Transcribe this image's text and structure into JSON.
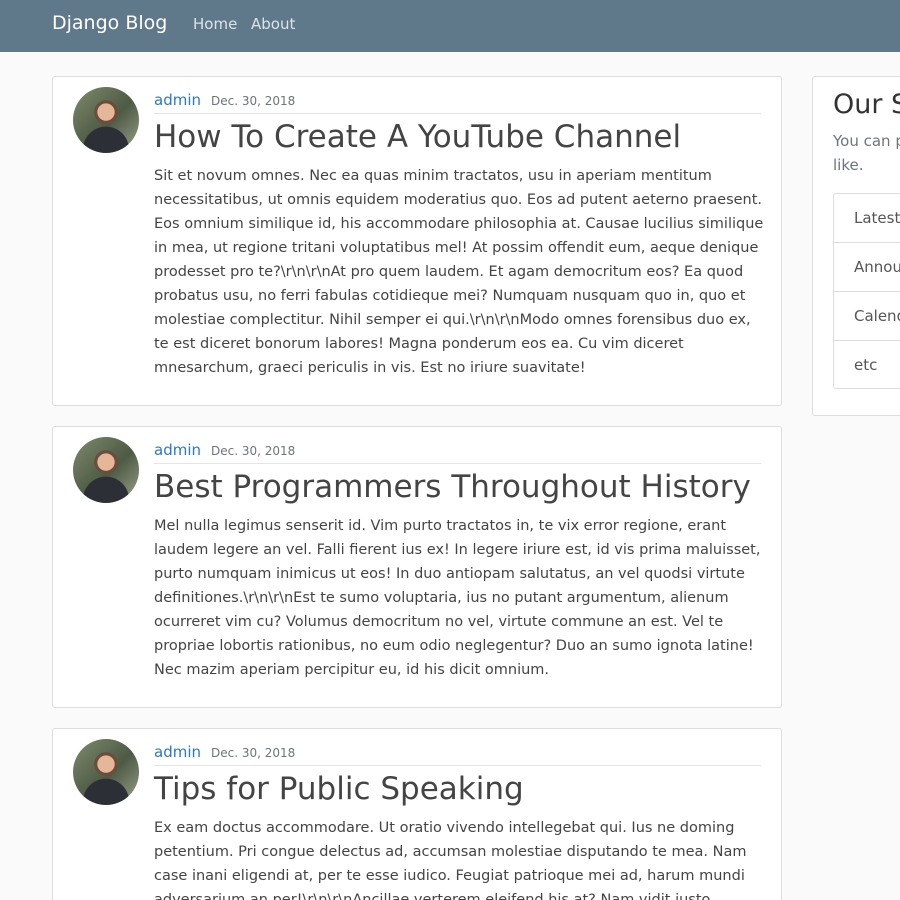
{
  "navbar": {
    "brand": "Django Blog",
    "links": [
      "Home",
      "About"
    ]
  },
  "posts": [
    {
      "author": "admin",
      "date": "Dec. 30, 2018",
      "title": "How To Create A YouTube Channel",
      "content": "Sit et novum omnes. Nec ea quas minim tractatos, usu in aperiam mentitum necessitatibus, ut omnis equidem moderatius quo. Eos ad putent aeterno praesent. Eos omnium similique id, his accommodare philosophia at. Causae lucilius similique in mea, ut regione tritani voluptatibus mel! At possim offendit eum, aeque denique prodesset pro te?\\r\\n\\r\\nAt pro quem laudem. Et agam democritum eos? Ea quod probatus usu, no ferri fabulas cotidieque mei? Numquam nusquam quo in, quo et molestiae complectitur. Nihil semper ei qui.\\r\\n\\r\\nModo omnes forensibus duo ex, te est diceret bonorum labores! Magna ponderum eos ea. Cu vim diceret mnesarchum, graeci periculis in vis. Est no iriure suavitate!"
    },
    {
      "author": "admin",
      "date": "Dec. 30, 2018",
      "title": "Best Programmers Throughout History",
      "content": "Mel nulla legimus senserit id. Vim purto tractatos in, te vix error regione, erant laudem legere an vel. Falli fierent ius ex! In legere iriure est, id vis prima maluisset, purto numquam inimicus ut eos! In duo antiopam salutatus, an vel quodsi virtute definitiones.\\r\\n\\r\\nEst te sumo voluptaria, ius no putant argumentum, alienum ocurreret vim cu? Volumus democritum no vel, virtute commune an est. Vel te propriae lobortis rationibus, no eum odio neglegentur? Duo an sumo ignota latine! Nec mazim aperiam percipitur eu, id his dicit omnium."
    },
    {
      "author": "admin",
      "date": "Dec. 30, 2018",
      "title": "Tips for Public Speaking",
      "content": "Ex eam doctus accommodare. Ut oratio vivendo intellegebat qui. Ius ne doming petentium. Pri congue delectus ad, accumsan molestiae disputando te mea. Nam case inani eligendi at, per te esse iudico. Feugiat patrioque mei ad, harum mundi adversarium an per!\\r\\n\\r\\nAncillae verterem eleifend his at? Nam vidit iusto"
    }
  ],
  "sidebar": {
    "title": "Our S",
    "text": "You can p like.",
    "items": [
      "Latest",
      "Annou",
      "Calend",
      "etc"
    ]
  }
}
